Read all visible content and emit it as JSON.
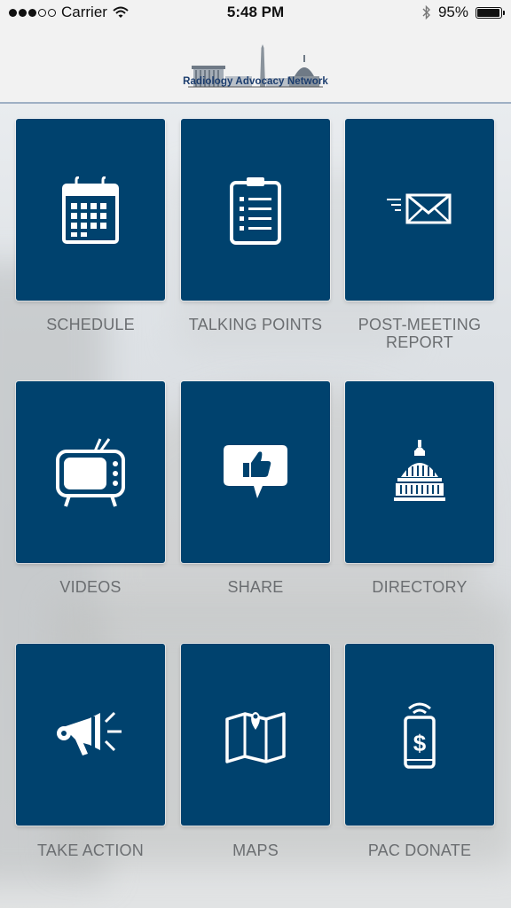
{
  "status_bar": {
    "carrier": "Carrier",
    "time": "5:48 PM",
    "battery_percent": "95%",
    "battery_level": 0.95,
    "signal_bars_filled": 3,
    "signal_bars_total": 5,
    "icons": [
      "wifi-icon",
      "bluetooth-icon",
      "battery-icon"
    ]
  },
  "header": {
    "logo_text": "Radiology Advocacy Network",
    "logo_icon": "capitol-skyline-logo"
  },
  "menu": [
    {
      "label": "SCHEDULE",
      "icon": "calendar-icon"
    },
    {
      "label": "TALKING POINTS",
      "icon": "clipboard-list-icon"
    },
    {
      "label_line1": "POST-MEETING",
      "label_line2": "REPORT",
      "icon": "mail-send-icon"
    },
    {
      "label": "VIDEOS",
      "icon": "tv-icon"
    },
    {
      "label": "SHARE",
      "icon": "thumbs-up-bubble-icon"
    },
    {
      "label": "DIRECTORY",
      "icon": "capitol-dome-icon"
    },
    {
      "label": "TAKE ACTION",
      "icon": "megaphone-icon"
    },
    {
      "label": "MAPS",
      "icon": "map-pin-icon"
    },
    {
      "label": "PAC DONATE",
      "icon": "phone-dollar-icon"
    }
  ],
  "colors": {
    "tile": "#00426e",
    "label": "#6b6e71",
    "brand_text": "#1c3d6e",
    "header_bg": "#f2f2f2"
  }
}
